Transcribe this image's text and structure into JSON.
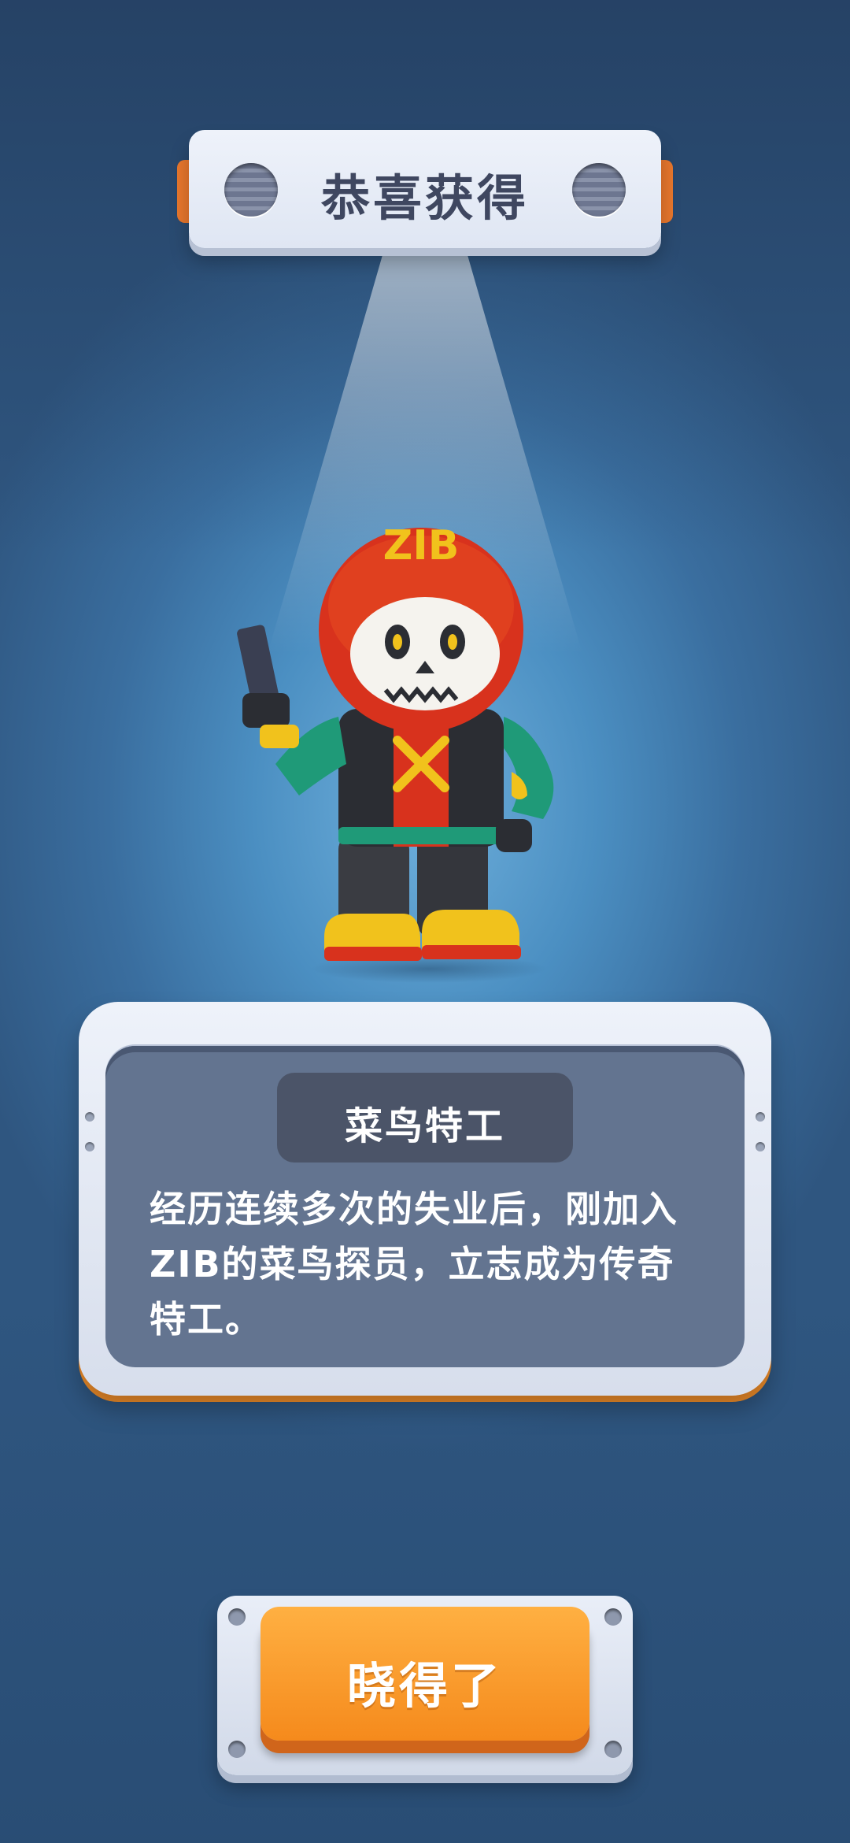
{
  "header": {
    "title": "恭喜获得"
  },
  "reward": {
    "name": "菜鸟特工",
    "description": "经历连续多次的失业后，刚加入ZIB的菜鸟探员，立志成为传奇特工。",
    "character_helmet_text": "ZIB"
  },
  "actions": {
    "confirm_label": "晓得了"
  },
  "colors": {
    "accent_orange": "#f58a1c",
    "panel_gray": "#637490",
    "background_blue": "#4b8fc2"
  }
}
